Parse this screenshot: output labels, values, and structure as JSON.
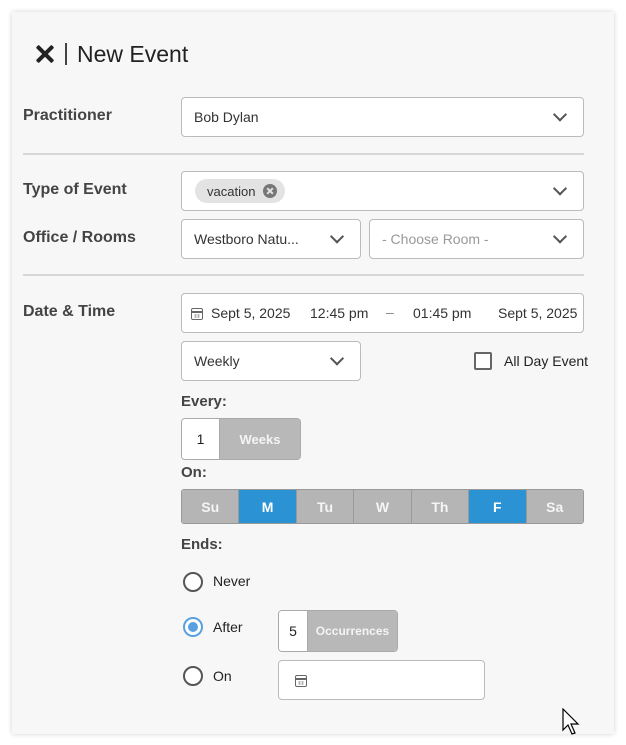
{
  "header": {
    "title": "New Event",
    "close_icon": "close-icon"
  },
  "practitioner": {
    "label": "Practitioner",
    "value": "Bob Dylan"
  },
  "event_type": {
    "label": "Type of Event",
    "chip": "vacation"
  },
  "office": {
    "label": "Office / Rooms",
    "location": "Westboro Natu...",
    "room_placeholder": "- Choose Room -"
  },
  "datetime": {
    "label": "Date & Time",
    "start_date": "Sept 5, 2025",
    "start_time": "12:45 pm",
    "dash": "–",
    "end_time": "01:45 pm",
    "end_date": "Sept 5, 2025",
    "recurrence": "Weekly",
    "all_day_label": "All Day Event"
  },
  "every": {
    "label": "Every:",
    "value": "1",
    "unit": "Weeks"
  },
  "on": {
    "label": "On:",
    "days": [
      {
        "label": "Su",
        "active": false
      },
      {
        "label": "M",
        "active": true
      },
      {
        "label": "Tu",
        "active": false
      },
      {
        "label": "W",
        "active": false
      },
      {
        "label": "Th",
        "active": false
      },
      {
        "label": "F",
        "active": true
      },
      {
        "label": "Sa",
        "active": false
      }
    ]
  },
  "ends": {
    "label": "Ends:",
    "never_label": "Never",
    "after_label": "After",
    "occurrences_value": "5",
    "occurrences_unit": "Occurrences",
    "on_label": "On",
    "selected": "after"
  },
  "colors": {
    "accent": "#2b93d3",
    "radio_accent": "#5aa0e0",
    "inactive_day": "#b5b5b5"
  }
}
